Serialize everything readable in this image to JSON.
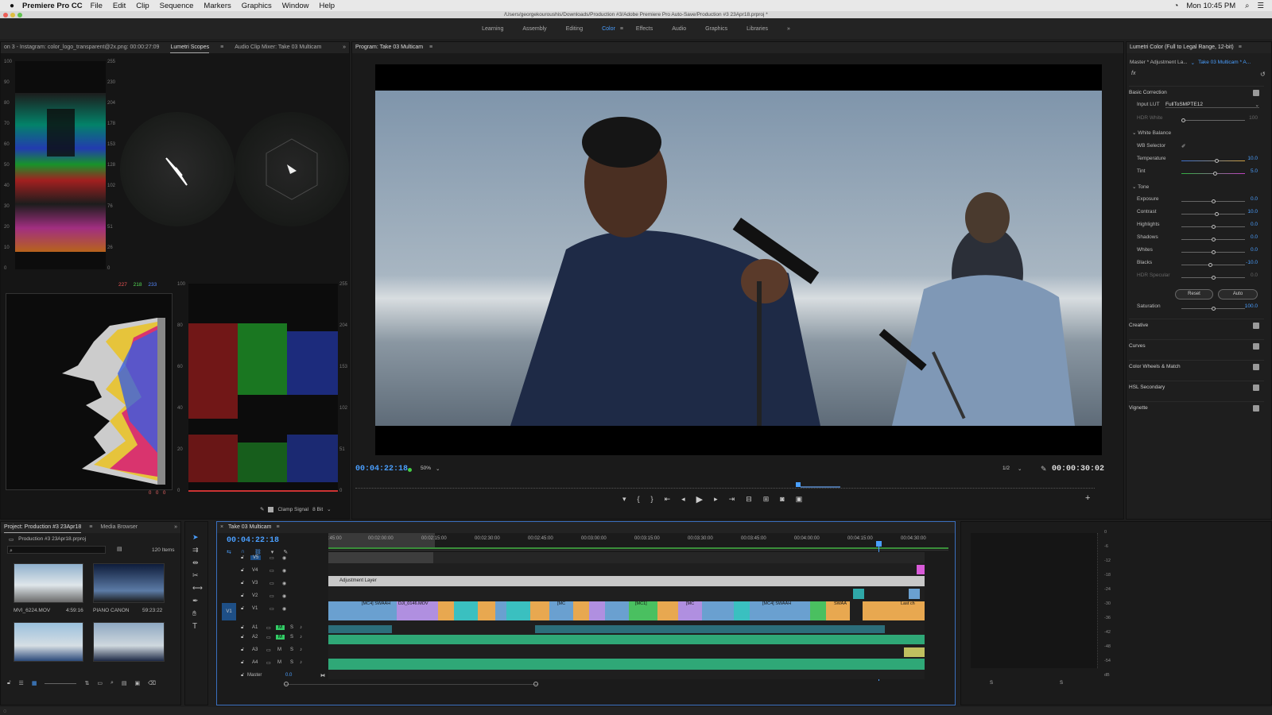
{
  "menubar": {
    "app": "Premiere Pro CC",
    "items": [
      "File",
      "Edit",
      "Clip",
      "Sequence",
      "Markers",
      "Graphics",
      "Window",
      "Help"
    ],
    "clock": "Mon 10:45 PM"
  },
  "window": {
    "path": "/Users/georgekouroushis/Downloads/Production #3/Adobe Premiere Pro Auto-Save/Production #3 23Apr18.prproj *"
  },
  "workspaces": [
    "Learning",
    "Assembly",
    "Editing",
    "Color",
    "Effects",
    "Audio",
    "Graphics",
    "Libraries"
  ],
  "scopes": {
    "tab_source": "on 3 - Instagram: color_logo_transparent@2x.png: 00:00:27:09",
    "tab_lumetri": "Lumetri Scopes",
    "tab_mixer": "Audio Clip Mixer: Take 03 Multicam",
    "left_axis": [
      "100",
      "90",
      "80",
      "70",
      "60",
      "50",
      "40",
      "30",
      "20",
      "10",
      "0"
    ],
    "right_axis": [
      "255",
      "230",
      "204",
      "178",
      "153",
      "128",
      "102",
      "76",
      "51",
      "26",
      "0"
    ],
    "rgb_readout": [
      "227",
      "218",
      "233"
    ],
    "clamp_label": "Clamp Signal",
    "bit_depth": "8 Bit",
    "hist_bottom": [
      "0",
      "0",
      "0"
    ]
  },
  "program": {
    "title": "Program: Take 03 Multicam",
    "timecode": "00:04:22:18",
    "zoom": "50%",
    "resolution": "1/2",
    "duration": "00:00:30:02"
  },
  "lumetri": {
    "title": "Lumetri Color (Full to Legal Range, 12-bit)",
    "master": "Master * Adjustment La...",
    "clip": "Take 03 Multicam * A...",
    "basic": "Basic Correction",
    "input_lut_label": "Input LUT",
    "input_lut": "FullToSMPTE12",
    "hdr_white": "HDR White",
    "hdr_white_val": "100",
    "white_balance": "White Balance",
    "wb_selector": "WB Selector",
    "temperature": "Temperature",
    "temperature_val": "10.0",
    "tint": "Tint",
    "tint_val": "5.0",
    "tone": "Tone",
    "exposure": "Exposure",
    "exposure_val": "0.0",
    "contrast": "Contrast",
    "contrast_val": "10.0",
    "highlights": "Highlights",
    "highlights_val": "0.0",
    "shadows": "Shadows",
    "shadows_val": "0.0",
    "whites": "Whites",
    "whites_val": "0.0",
    "blacks": "Blacks",
    "blacks_val": "-10.0",
    "hdr_specular": "HDR Specular",
    "hdr_specular_val": "0.0",
    "reset": "Reset",
    "auto": "Auto",
    "saturation": "Saturation",
    "saturation_val": "100.0",
    "sections": [
      "Creative",
      "Curves",
      "Color Wheels & Match",
      "HSL Secondary",
      "Vignette"
    ]
  },
  "project": {
    "tab": "Project: Production #3 23Apr18",
    "tab2": "Media Browser",
    "file": "Production #3 23Apr18.prproj",
    "count": "120 Items",
    "items": [
      {
        "name": "MVI_6224.MOV",
        "dur": "4:59:16"
      },
      {
        "name": "PIANO CANON",
        "dur": "59:23:22"
      }
    ]
  },
  "timeline": {
    "tab": "Take 03 Multicam",
    "timecode": "00:04:22:18",
    "ruler": [
      ":45:00",
      "00:02:00:00",
      "00:02:15:00",
      "00:02:30:00",
      "00:02:45:00",
      "00:03:00:00",
      "00:03:15:00",
      "00:03:30:00",
      "00:03:45:00",
      "00:04:00:00",
      "00:04:15:00",
      "00:04:30:00"
    ],
    "tracks_v": [
      "V5",
      "V4",
      "V3",
      "V2",
      "V1"
    ],
    "tracks_a": [
      "A1",
      "A2",
      "A3",
      "A4"
    ],
    "master": "Master",
    "master_val": "0.0",
    "adj_layer": "Adjustment Layer",
    "clip_labels": [
      "[MC4] SWAAH",
      "DJI_0146.MOV",
      "[MC",
      "[MC1]",
      "[MC",
      "[MC4] SWAAH",
      "SWAA",
      "Last ch"
    ]
  },
  "meters": [
    "0",
    "-6",
    "-12",
    "-18",
    "-24",
    "-30",
    "-36",
    "-42",
    "-48",
    "-54",
    "dB"
  ]
}
